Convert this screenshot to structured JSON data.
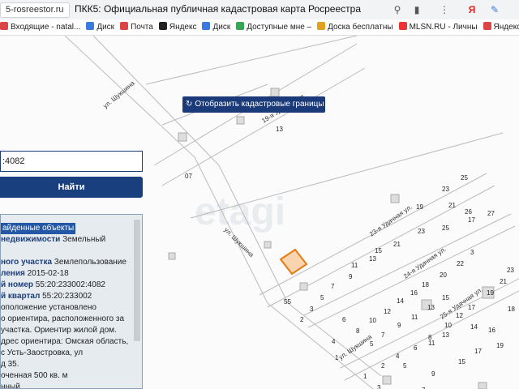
{
  "browser": {
    "domain": "5-rosreestor.ru",
    "page_title": "ПКК5: Официальная публичная кадастровая карта Росреестра",
    "icons": [
      "location-pin-icon",
      "bookmark-icon",
      "menu-icon",
      "yandex-icon",
      "feather-icon"
    ]
  },
  "bookmarks": [
    {
      "label": "Входящие - natal...",
      "color": "#d44"
    },
    {
      "label": "Диск",
      "color": "#3a7be0"
    },
    {
      "label": "Почта",
      "color": "#d44"
    },
    {
      "label": "Яндекс",
      "color": "#222"
    },
    {
      "label": "Диск",
      "color": "#3a7be0"
    },
    {
      "label": "Доступные мне –",
      "color": "#34a853"
    },
    {
      "label": "Доска бесплатны",
      "color": "#e0a020"
    },
    {
      "label": "MLSN.RU - Личны",
      "color": "#e33"
    },
    {
      "label": "Яндекс.Почта",
      "color": "#d44"
    }
  ],
  "map": {
    "button_label": "Отобразить кадастровые границы",
    "watermark": "etagi",
    "streets": {
      "s1": "ул. Шукшина",
      "s2": "19-я Удачная ул.",
      "s3": "ул. Шукшина",
      "s4": "23-я Удачная ул.",
      "s5": "24-я Удачная ул.",
      "s6": "25-я Удачная ул.",
      "s7": "ул. Шукшина"
    },
    "numbers": [
      "13",
      "07",
      "25",
      "23",
      "19",
      "21",
      "27",
      "26",
      "17",
      "25",
      "23",
      "21",
      "15",
      "13",
      "11",
      "9",
      "7",
      "5",
      "3",
      "55",
      "2",
      "4",
      "6",
      "8",
      "10",
      "12",
      "14",
      "16",
      "18",
      "20",
      "22",
      "3",
      "5",
      "7",
      "9",
      "11",
      "13",
      "15",
      "17",
      "19",
      "21",
      "23",
      "1",
      "2",
      "4",
      "6",
      "8",
      "10",
      "12",
      "14",
      "16",
      "18",
      "11",
      "13",
      "15",
      "17",
      "19",
      "1",
      "3",
      "5",
      "7",
      "9"
    ]
  },
  "search": {
    "value": ":4082",
    "button_label": "Найти"
  },
  "results": {
    "header": "айденные объекты",
    "lines": [
      {
        "label": "недвижимости",
        "value": " Земельный"
      },
      {
        "label": "",
        "value": ""
      },
      {
        "label": "ного участка",
        "value": " Землепользование"
      },
      {
        "label": "ления",
        "value": " 2015-02-18"
      },
      {
        "label": "й номер",
        "value": " 55:20:233002:4082"
      },
      {
        "label": "й квартал",
        "value": " 55:20:233002"
      },
      {
        "label": "",
        "value": "оположение установлено"
      },
      {
        "label": "",
        "value": "о ориентира, расположенного за"
      },
      {
        "label": "",
        "value": "участка. Ориентир жилой дом."
      },
      {
        "label": "",
        "value": "дрес ориентира: Омская область,"
      },
      {
        "label": "",
        "value": "с Усть-Заостровка, ул"
      },
      {
        "label": "",
        "value": "д 35."
      },
      {
        "label": "",
        "value": "оченная 500 кв. м"
      },
      {
        "label": "",
        "value": "нный"
      }
    ]
  }
}
